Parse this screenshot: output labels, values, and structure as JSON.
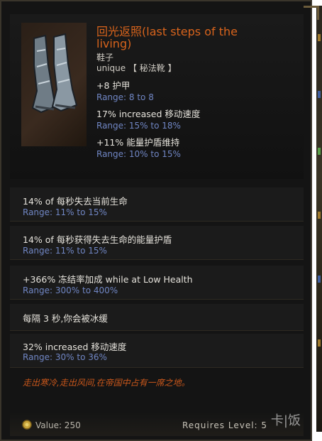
{
  "item": {
    "name": "回光返照(last steps of the living)",
    "type": "鞋子",
    "rarity_line": "unique 【 秘法靴 】",
    "icon": "boots-icon"
  },
  "implicits": [
    {
      "text": "+8 护甲",
      "range": "Range: 8 to 8"
    },
    {
      "text": "17% increased 移动速度",
      "range": "Range: 15% to 18%"
    },
    {
      "text": "+11% 能量护盾维持",
      "range": "Range: 10% to 15%"
    }
  ],
  "affixes": [
    {
      "text": "14% of 每秒失去当前生命",
      "range": "Range: 11% to 15%"
    },
    {
      "text": "14% of 每秒获得失去生命的能量护盾",
      "range": "Range: 11% to 15%"
    },
    {
      "text": "+366% 冻结率加成 while at Low Health",
      "range": "Range: 300% to 400%"
    },
    {
      "text": "每隔 3 秒,你会被冰缓"
    },
    {
      "text": "32% increased 移动速度",
      "range": "Range: 30% to 36%"
    }
  ],
  "flavor": "走出寒冷,走出风间,在帝国中占有一席之地。",
  "footer": {
    "value_text": "Value: 250",
    "requires_text": "Requires Level: 5"
  },
  "watermark": "卡|饭",
  "colors": {
    "title": "#d9641c",
    "range": "#7086c4",
    "stat": "#e6e3dc",
    "flavor": "#c9571b",
    "background": "#141414"
  }
}
